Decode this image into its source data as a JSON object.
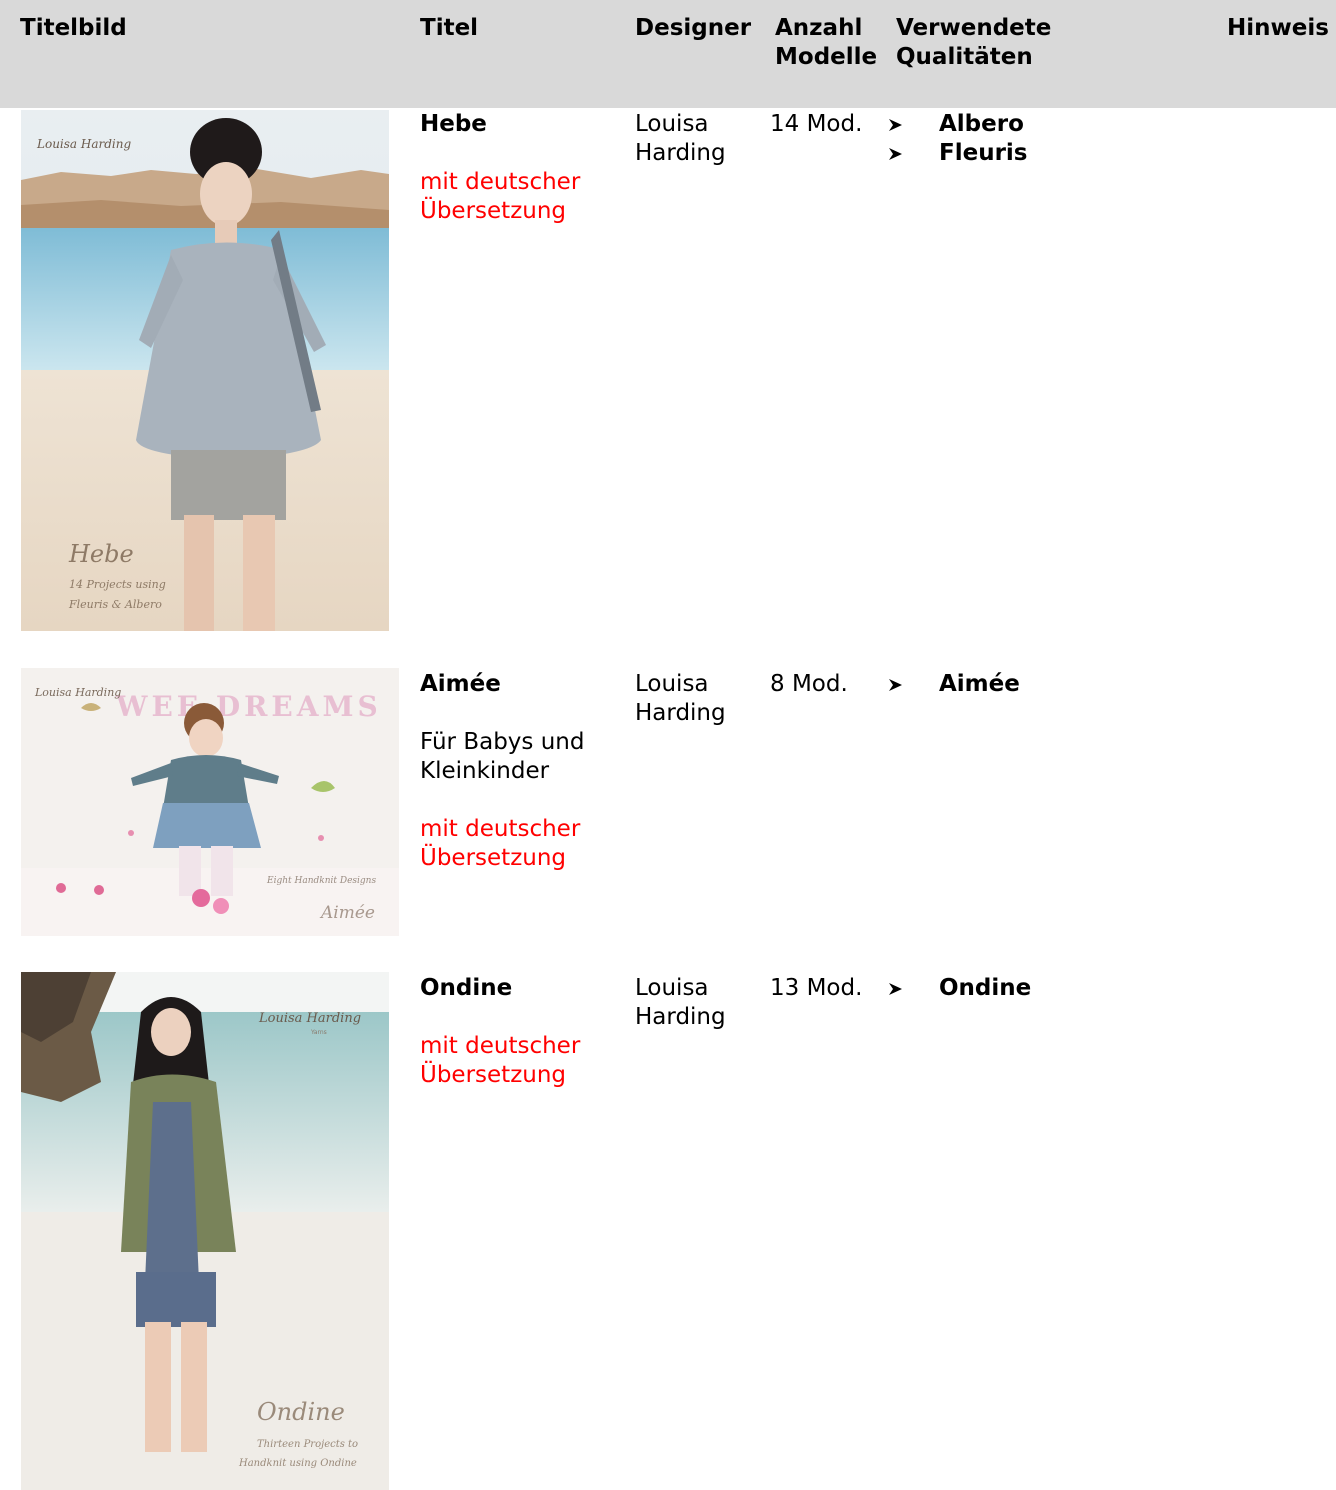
{
  "header": {
    "titelbild": "Titelbild",
    "titel": "Titel",
    "designer": "Designer",
    "anzahl": [
      "Anzahl",
      "Modelle"
    ],
    "qualitaeten": [
      "Verwendete",
      "Qualitäten"
    ],
    "hinweis": "Hinweis"
  },
  "rows": [
    {
      "title": "Hebe",
      "subtitle": "",
      "note": [
        "mit deutscher",
        "Übersetzung"
      ],
      "designer": [
        "Louisa",
        "Harding"
      ],
      "models": "14 Mod.",
      "qualities": [
        "Albero",
        "Fleuris"
      ],
      "cover": {
        "brand": "Louisa Harding",
        "brand_sub": "",
        "script_title": "Hebe",
        "script_lines": [
          "14 Projects using",
          "Fleuris & Albero"
        ]
      }
    },
    {
      "title": "Aimée",
      "subtitle": [
        "Für Babys und",
        "Kleinkinder"
      ],
      "note": [
        "mit deutscher",
        "Übersetzung"
      ],
      "designer": [
        "Louisa",
        "Harding"
      ],
      "models": "8 Mod.",
      "qualities": [
        "Aimée"
      ],
      "cover": {
        "brand": "Louisa Harding",
        "banner": "WEE DREAMS",
        "script_line": "Eight Handknit Designs",
        "script_title": "Aimée"
      }
    },
    {
      "title": "Ondine",
      "subtitle": "",
      "note": [
        "mit deutscher",
        "Übersetzung"
      ],
      "designer": [
        "Louisa",
        "Harding"
      ],
      "models": "13 Mod.",
      "qualities": [
        "Ondine"
      ],
      "cover": {
        "brand": "Louisa Harding",
        "brand_sub": "Yarns",
        "script_title": "Ondine",
        "script_lines": [
          "Thirteen Projects to",
          "Handknit using Ondine"
        ]
      }
    }
  ],
  "colors": {
    "header_bg": "#d9d9d9",
    "note_red": "#ff0000"
  },
  "icons": [
    "arrowhead-bullet-icon"
  ]
}
